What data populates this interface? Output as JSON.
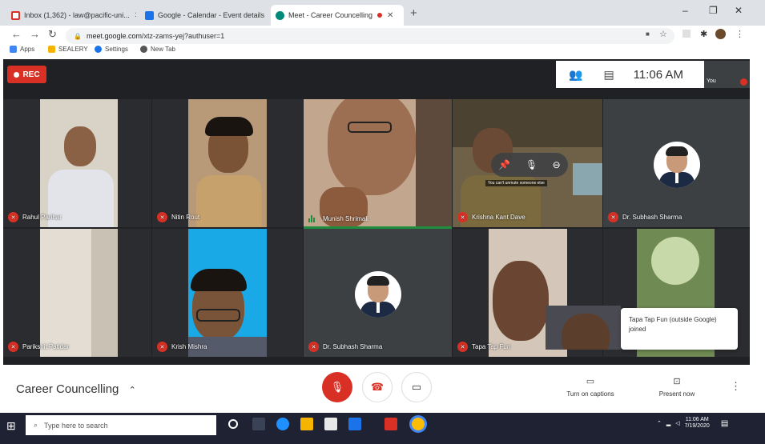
{
  "browser": {
    "tabs": [
      {
        "label": "Inbox (1,362) - law@pacific-uni...",
        "icon": "gmail-icon",
        "active": false,
        "icon_color": "#d93025"
      },
      {
        "label": "Google - Calendar - Event details",
        "icon": "calendar-icon",
        "active": false,
        "icon_color": "#1a73e8"
      },
      {
        "label": "Meet - Career Councelling",
        "icon": "meet-icon",
        "active": true,
        "icon_color": "#00897b"
      }
    ],
    "url_host": "meet.google.com",
    "url_path": "/xtz-zams-yej?authuser=1",
    "bookmarks": [
      {
        "label": "Apps",
        "icon": "apps-icon",
        "color": "#4285f4"
      },
      {
        "label": "SEALERY",
        "icon": "folder-icon",
        "color": "#f4b400"
      },
      {
        "label": "Settings",
        "icon": "settings-icon",
        "color": "#1a73e8"
      },
      {
        "label": "New Tab",
        "icon": "globe-icon",
        "color": "#555555"
      }
    ]
  },
  "meet": {
    "rec_label": "REC",
    "time": "11:06 AM",
    "self_label": "You",
    "participants": [
      {
        "name": "Rahul Parihar",
        "muted": true
      },
      {
        "name": "Nitin Rout",
        "muted": true
      },
      {
        "name": "Munish Shrimali",
        "muted": false,
        "speaking": true
      },
      {
        "name": "Krishna Kant Dave",
        "muted": true
      },
      {
        "name": "Dr. Subhash Sharma",
        "muted": true
      },
      {
        "name": "Parikshit Patidar",
        "muted": true
      },
      {
        "name": "Krish Mishra",
        "muted": true
      },
      {
        "name": "Dr. Subhash Sharma",
        "muted": true
      },
      {
        "name": "Tapa Tap Fun",
        "muted": true
      }
    ],
    "hover_tip": "You can't unmute someone else",
    "toast": "Tapa Tap Fun (outside Google) joined",
    "meeting_name": "Career Councelling",
    "captions_label": "Turn on captions",
    "present_label": "Present now"
  },
  "taskbar": {
    "search_placeholder": "Type here to search",
    "clock_time": "11:06 AM",
    "clock_date": "7/19/2020"
  },
  "colors": {
    "accent_red": "#d93025",
    "meet_bg": "#202124",
    "speaking_green": "#1e8e3e"
  }
}
